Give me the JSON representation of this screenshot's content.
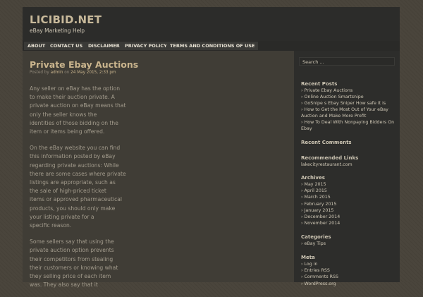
{
  "header": {
    "title": "LICIBID.NET",
    "description": "eBay Marketing Help"
  },
  "nav": {
    "items": [
      "ABOUT",
      "CONTACT US",
      "DISCLAIMER",
      "PRIVACY POLICY",
      "TERMS AND CONDITIONS OF USE"
    ]
  },
  "post": {
    "title": "Private Ebay Auctions",
    "meta_prefix": "Posted by",
    "author": "admin",
    "meta_on": "on",
    "date": "24 May 2015, 2:33 pm",
    "paragraphs": [
      {
        "lines": [
          "Any seller on eBay has the option",
          "to make their auction private. A",
          "private auction on eBay means that",
          "only the seller knows the",
          "identities of those bidding on the",
          "item or items being offered."
        ]
      },
      {
        "lines": [
          "On the eBay website you can find",
          "this information posted by eBay",
          "regarding private auctions: While",
          "there are some cases where private",
          "listings are appropriate, such as",
          "the sale of high-priced ticket",
          "items or approved pharmaceutical",
          "products, you should only make",
          "your listing private for a",
          "specific reason."
        ]
      },
      {
        "lines": [
          "Some sellers say that using the",
          "private auction option prevents",
          "their competitors from stealing",
          "their customers or knowing what",
          "they selling price of each item",
          "was. They also say that it"
        ]
      }
    ]
  },
  "sidebar": {
    "search_placeholder": "Search ...",
    "recent_posts": {
      "title": "Recent Posts",
      "items": [
        "Private Ebay Auctions",
        "Online Auction Smartsnipe",
        "GoSnipe s Ebay Sniper How safe it is",
        "How to Get the Most Out of Your eBay",
        "Auction and Make More Profit",
        "How To Deal With Nonpaying Bidders On",
        "Ebay"
      ]
    },
    "recent_comments": {
      "title": "Recent Comments"
    },
    "recommended": {
      "title": "Recommended Links",
      "items": [
        "lakecityrestaurant.com"
      ]
    },
    "archives": {
      "title": "Archives",
      "items": [
        "May 2015",
        "April 2015",
        "March 2015",
        "February 2015",
        "January 2015",
        "December 2014",
        "November 2014"
      ]
    },
    "categories": {
      "title": "Categories",
      "items": [
        "eBay Tips"
      ]
    },
    "meta": {
      "title": "Meta",
      "items": [
        "Log in",
        "Entries RSS",
        "Comments RSS",
        "WordPress.org"
      ]
    }
  }
}
